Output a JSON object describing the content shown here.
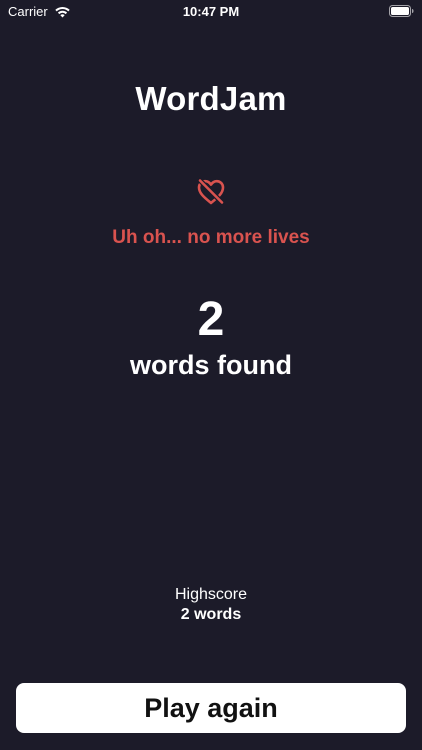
{
  "status_bar": {
    "carrier": "Carrier",
    "time": "10:47 PM",
    "icons": [
      "wifi-icon",
      "battery-icon"
    ]
  },
  "app": {
    "title": "WordJam"
  },
  "game_over": {
    "icon": "heart-slash-icon",
    "icon_color": "#d9534f",
    "message": "Uh oh... no more lives",
    "message_color": "#d9534f"
  },
  "result": {
    "score": "2",
    "score_label": "words found"
  },
  "highscore": {
    "label": "Highscore",
    "value": "2 words"
  },
  "actions": {
    "play_again_label": "Play again"
  },
  "colors": {
    "background": "#1c1b29",
    "text": "#ffffff",
    "accent": "#d9534f",
    "button_bg": "#ffffff"
  }
}
